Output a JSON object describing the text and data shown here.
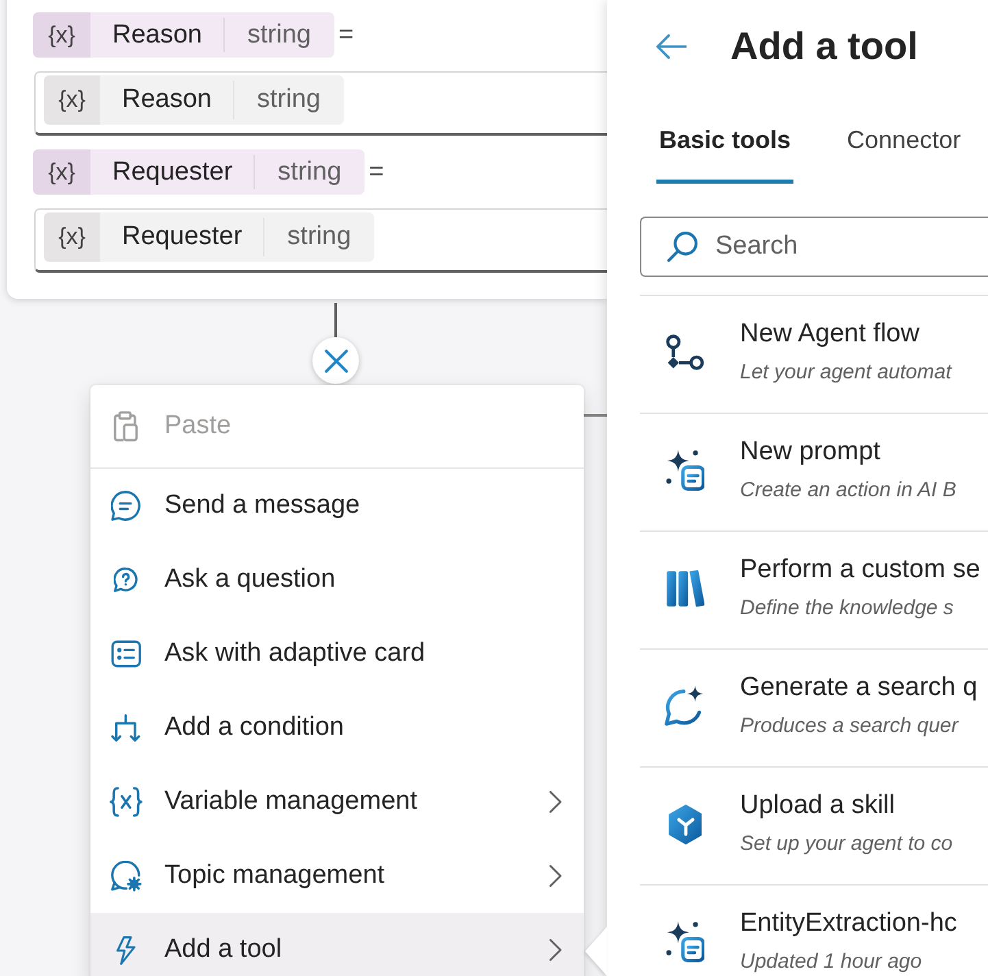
{
  "assignment_node": {
    "assignments": [
      {
        "variable": {
          "badge": "{x}",
          "name": "Reason",
          "type": "string"
        },
        "operator": "=",
        "value": {
          "badge": "{x}",
          "name": "Reason",
          "type": "string"
        }
      },
      {
        "variable": {
          "badge": "{x}",
          "name": "Requester",
          "type": "string"
        },
        "operator": "=",
        "value": {
          "badge": "{x}",
          "name": "Requester",
          "type": "string"
        }
      }
    ]
  },
  "step_menu": {
    "sections": [
      {
        "items": [
          {
            "label": "Paste",
            "disabled": true,
            "selected": false,
            "submenu": false
          }
        ]
      },
      {
        "items": [
          {
            "label": "Send a message",
            "disabled": false,
            "selected": false,
            "submenu": false
          },
          {
            "label": "Ask a question",
            "disabled": false,
            "selected": false,
            "submenu": false
          },
          {
            "label": "Ask with adaptive card",
            "disabled": false,
            "selected": false,
            "submenu": false
          },
          {
            "label": "Add a condition",
            "disabled": false,
            "selected": false,
            "submenu": false
          },
          {
            "label": "Variable management",
            "disabled": false,
            "selected": false,
            "submenu": true
          },
          {
            "label": "Topic management",
            "disabled": false,
            "selected": false,
            "submenu": true
          },
          {
            "label": "Add a tool",
            "disabled": false,
            "selected": true,
            "submenu": true
          }
        ]
      }
    ]
  },
  "tool_panel": {
    "title": "Add a tool",
    "tabs": [
      {
        "label": "Basic tools",
        "selected": true
      },
      {
        "label": "Connector",
        "selected": false
      }
    ],
    "search": {
      "placeholder": "Search"
    },
    "tools": [
      {
        "kind": "flow",
        "title": "New Agent flow",
        "description": "Let your agent automat"
      },
      {
        "kind": "prompt",
        "title": "New prompt",
        "description": "Create an action in AI B"
      },
      {
        "kind": "knowledge",
        "title": "Perform a custom se",
        "description": "Define the knowledge s"
      },
      {
        "kind": "query",
        "title": "Generate a search q",
        "description": "Produces a search quer"
      },
      {
        "kind": "skill",
        "title": "Upload a skill",
        "description": "Set up your agent to co"
      },
      {
        "kind": "prompt",
        "title": "EntityExtraction-hc",
        "description": "Updated 1 hour ago"
      }
    ]
  }
}
